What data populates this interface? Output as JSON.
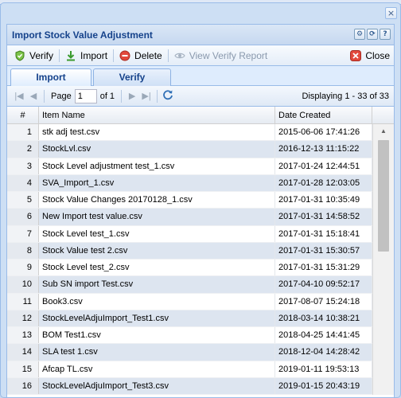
{
  "panel": {
    "title": "Import Stock Value Adjustment"
  },
  "window": {
    "close_glyph": "×"
  },
  "tools": {
    "gear": "⚙",
    "refresh": "⟳",
    "help": "?"
  },
  "toolbar": {
    "verify": "Verify",
    "import": "Import",
    "delete": "Delete",
    "view_verify_report": "View Verify Report",
    "close": "Close"
  },
  "tabs": [
    {
      "label": "Import",
      "active": true
    },
    {
      "label": "Verify",
      "active": false
    }
  ],
  "paging": {
    "page_label": "Page",
    "page_value": "1",
    "of_label": "of 1",
    "display": "Displaying 1 - 33 of 33"
  },
  "grid": {
    "columns": {
      "num": "#",
      "name": "Item Name",
      "date": "Date Created"
    },
    "rows": [
      {
        "num": "1",
        "name": "stk adj test.csv",
        "date": "2015-06-06 17:41:26"
      },
      {
        "num": "2",
        "name": "StockLvl.csv",
        "date": "2016-12-13 11:15:22"
      },
      {
        "num": "3",
        "name": "Stock Level adjustment test_1.csv",
        "date": "2017-01-24 12:44:51"
      },
      {
        "num": "4",
        "name": "SVA_Import_1.csv",
        "date": "2017-01-28 12:03:05"
      },
      {
        "num": "5",
        "name": "Stock Value Changes 20170128_1.csv",
        "date": "2017-01-31 10:35:49"
      },
      {
        "num": "6",
        "name": "New Import test value.csv",
        "date": "2017-01-31 14:58:52"
      },
      {
        "num": "7",
        "name": "Stock Level test_1.csv",
        "date": "2017-01-31 15:18:41"
      },
      {
        "num": "8",
        "name": "Stock Value test 2.csv",
        "date": "2017-01-31 15:30:57"
      },
      {
        "num": "9",
        "name": "Stock Level test_2.csv",
        "date": "2017-01-31 15:31:29"
      },
      {
        "num": "10",
        "name": "Sub SN import Test.csv",
        "date": "2017-04-10 09:52:17"
      },
      {
        "num": "11",
        "name": "Book3.csv",
        "date": "2017-08-07 15:24:18"
      },
      {
        "num": "12",
        "name": "StockLevelAdjuImport_Test1.csv",
        "date": "2018-03-14 10:38:21"
      },
      {
        "num": "13",
        "name": "BOM Test1.csv",
        "date": "2018-04-25 14:41:45"
      },
      {
        "num": "14",
        "name": "SLA test 1.csv",
        "date": "2018-12-04 14:28:42"
      },
      {
        "num": "15",
        "name": "Afcap TL.csv",
        "date": "2019-01-11 19:53:13"
      },
      {
        "num": "16",
        "name": "StockLevelAdjuImport_Test3.csv",
        "date": "2019-01-15 20:43:19"
      }
    ]
  },
  "colors": {
    "accent": "#15428b",
    "border": "#99bbe8",
    "row_alt": "#dde5f0"
  },
  "icons": {
    "verify": "shield-check-icon",
    "import": "import-arrow-icon",
    "delete": "delete-circle-icon",
    "view_verify_report": "eye-icon",
    "close": "close-x-icon",
    "refresh": "refresh-icon"
  }
}
